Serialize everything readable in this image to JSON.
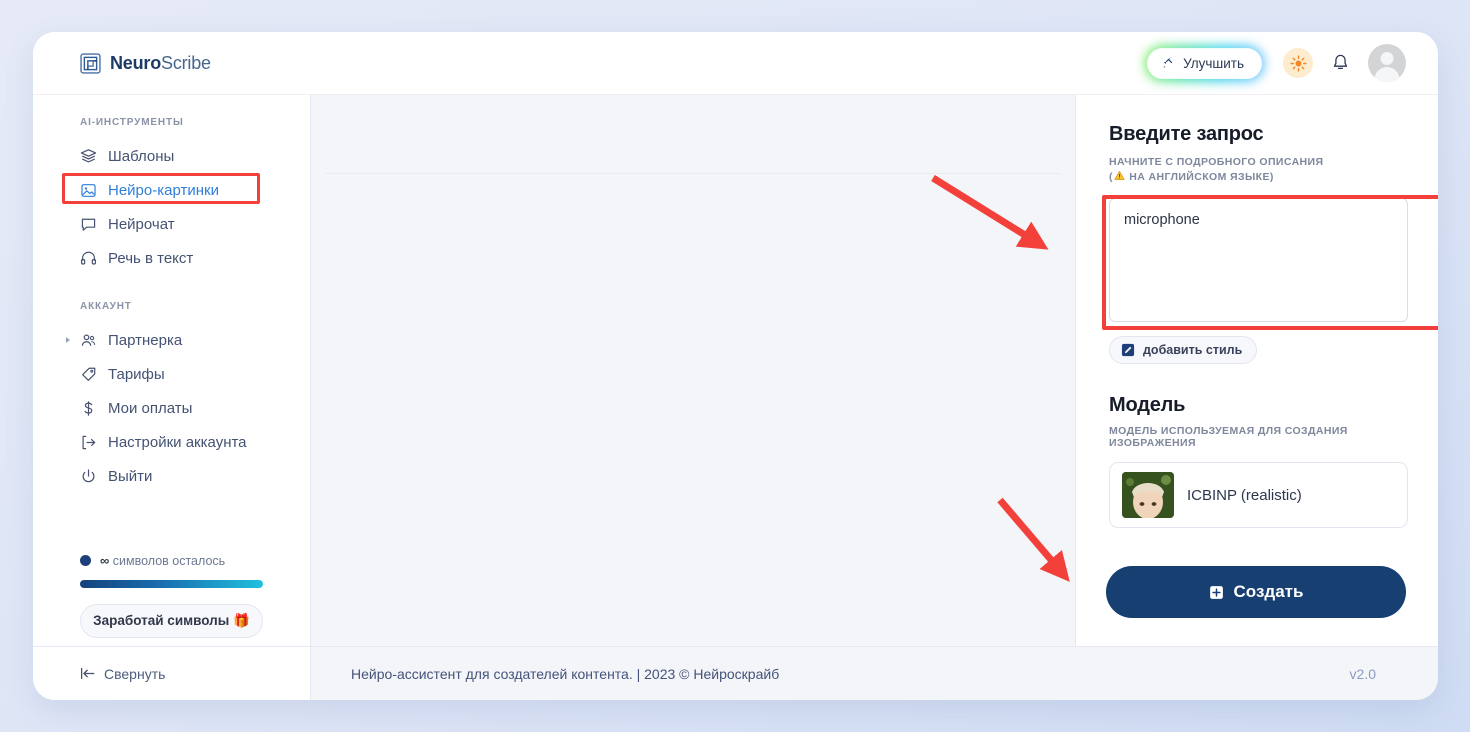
{
  "brand": {
    "name_bold": "Neuro",
    "name_light": "Scribe",
    "logo_icon": "nested-square-logo-icon"
  },
  "header": {
    "upgrade_label": "Улучшить",
    "upgrade_icon": "rocket-icon",
    "theme_icon": "sun-icon",
    "notifications_icon": "bell-icon",
    "avatar_icon": "user-avatar-icon",
    "accent_glow": "#46e0a8"
  },
  "sidebar": {
    "tools_caption": "AI-ИНСТРУМЕНТЫ",
    "tools": [
      {
        "label": "Шаблоны",
        "icon": "layers-icon",
        "active": false
      },
      {
        "label": "Нейро-картинки",
        "icon": "image-icon",
        "active": true
      },
      {
        "label": "Нейрочат",
        "icon": "chat-bubble-icon",
        "active": false
      },
      {
        "label": "Речь в текст",
        "icon": "headphones-icon",
        "active": false
      }
    ],
    "account_caption": "АККАУНТ",
    "account": [
      {
        "label": "Партнерка",
        "icon": "users-icon",
        "expandable": true
      },
      {
        "label": "Тарифы",
        "icon": "tag-icon",
        "expandable": false
      },
      {
        "label": "Мои оплаты",
        "icon": "dollar-icon",
        "expandable": false
      },
      {
        "label": "Настройки аккаунта",
        "icon": "logout-arrow-icon",
        "expandable": false
      },
      {
        "label": "Выйти",
        "icon": "power-icon",
        "expandable": false
      }
    ],
    "tokens_infinity": "∞",
    "tokens_label": "символов осталось",
    "earn_label": "Заработай символы 🎁",
    "progress_gradient_start": "#15427c",
    "progress_gradient_end": "#1fc0dd"
  },
  "right_panel": {
    "prompt_heading": "Введите запрос",
    "prompt_sub_line1": "НАЧНИТЕ С ПОДРОБНОГО ОПИСАНИЯ",
    "prompt_sub_line2_pre": "(",
    "prompt_sub_line2_post": " НА АНГЛИЙСКОМ ЯЗЫКЕ)",
    "prompt_value": "microphone",
    "prompt_placeholder": "",
    "style_button_label": "добавить стиль",
    "style_button_icon": "pencil-square-icon",
    "model_heading": "Модель",
    "model_sub": "МОДЕЛЬ ИСПОЛЬЗУЕМАЯ ДЛЯ СОЗДАНИЯ ИЗОБРАЖЕНИЯ",
    "model_name": "ICBINP (realistic)",
    "create_label": "Создать",
    "create_icon": "plus-square-icon",
    "create_color": "#173f72"
  },
  "footer": {
    "collapse_label": "Свернуть",
    "collapse_icon": "collapse-left-icon",
    "credit": "Нейро-ассистент для создателей контента.  | 2023 © Нейроскрайб",
    "version": "v2.0"
  },
  "annotations": {
    "highlight_color": "#f3403a",
    "arrow_color": "#f3403a",
    "highlighted_nav": "Нейро-картинки",
    "highlighted_field": "prompt-textarea",
    "arrow_targets": [
      "prompt-textarea",
      "create-button"
    ]
  }
}
